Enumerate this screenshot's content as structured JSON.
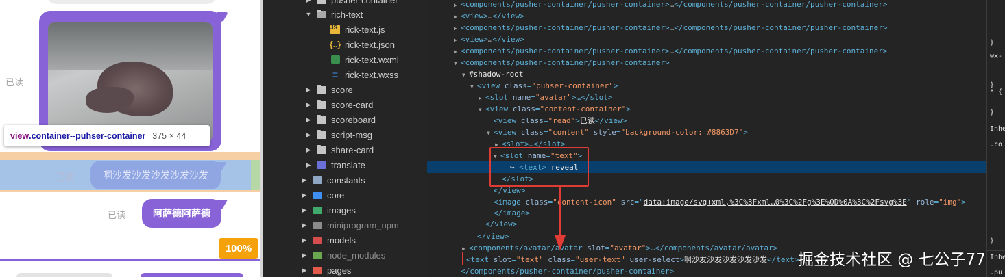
{
  "simulator": {
    "read_label_1": "已读",
    "tooltip": {
      "tag": "view",
      "class_name": ".container--puhser-container",
      "dims": "375 × 44"
    },
    "read_label_2": "已读",
    "highlight_text": "啊沙发沙发沙发沙发沙发",
    "read_label_3": "已读",
    "message_text": "阿萨德阿萨德",
    "percent_badge": "100%"
  },
  "file_tree": {
    "items": [
      {
        "label": "pusher-container",
        "type": "folder"
      },
      {
        "label": "rich-text",
        "type": "folder-open"
      },
      {
        "label": "rick-text.js",
        "type": "js"
      },
      {
        "label": "rick-text.json",
        "type": "json"
      },
      {
        "label": "rick-text.wxml",
        "type": "wxml"
      },
      {
        "label": "rick-text.wxss",
        "type": "wxss"
      },
      {
        "label": "score",
        "type": "folder"
      },
      {
        "label": "score-card",
        "type": "folder"
      },
      {
        "label": "scoreboard",
        "type": "folder"
      },
      {
        "label": "script-msg",
        "type": "folder"
      },
      {
        "label": "share-card",
        "type": "folder"
      },
      {
        "label": "translate",
        "type": "translate"
      },
      {
        "label": "constants",
        "type": "constants"
      },
      {
        "label": "core",
        "type": "core"
      },
      {
        "label": "images",
        "type": "images"
      },
      {
        "label": "miniprogram_npm",
        "type": "npm"
      },
      {
        "label": "models",
        "type": "models"
      },
      {
        "label": "node_modules",
        "type": "node"
      },
      {
        "label": "pages",
        "type": "pages"
      }
    ]
  },
  "elements": {
    "rows": [
      {
        "open": "<components/pusher-container/pusher-container>",
        "ellipsis": "…",
        "close": "</components/pusher-container/pusher-container>"
      },
      {
        "open": "<view>",
        "ellipsis": "…",
        "close": "</view>"
      },
      {
        "open": "<components/pusher-container/pusher-container>",
        "ellipsis": "…",
        "close": "</components/pusher-container/pusher-container>"
      },
      {
        "open": "<view>",
        "ellipsis": "…",
        "close": "</view>"
      },
      {
        "open": "<components/pusher-container/pusher-container>",
        "ellipsis": "…",
        "close": "</components/pusher-container/pusher-container>"
      },
      {
        "open": "<components/pusher-container/pusher-container>"
      }
    ],
    "shadow_root": "#shadow-root",
    "view_puhser": {
      "tag": "<view",
      "attr": "class",
      "val": "\"puhser-container\"",
      "end": ">"
    },
    "slot_avatar": {
      "tag": "<slot",
      "attr": "name",
      "val": "\"avatar\"",
      "end": ">…</slot>"
    },
    "view_content_container": {
      "tag": "<view",
      "attr": "class",
      "val": "\"content-container\"",
      "end": ">"
    },
    "view_read": {
      "tag": "<view",
      "attr": "class",
      "val": "\"read\"",
      "text": "已读",
      "close": "</view>"
    },
    "view_content": {
      "tag": "<view",
      "attr1": "class",
      "val1": "\"content\"",
      "attr2": "style",
      "val2": "\"background-color: #8863D7\"",
      "end": ">"
    },
    "slot_collapsed": "<slot>…</slot>",
    "slot_text": {
      "tag": "<slot",
      "attr": "name",
      "val": "\"text\"",
      "end": ">"
    },
    "reveal_row": {
      "arrow": "↪",
      "tag": "<text>",
      "text": "reveal"
    },
    "slot_close": "</slot>",
    "view_close_1": "</view>",
    "image_row": {
      "tag": "<image",
      "attr1": "class",
      "val1": "\"content-icon\"",
      "attr2": "src",
      "val2": "data:image/svg+xml,%3C%3Fxml…0%3C%2Fg%3E%0D%0A%3C%2Fsvg%3E",
      "attr3": "role",
      "val3": "\"img\"",
      "end": ">"
    },
    "image_close": "</image>",
    "view_close_2": "</view>",
    "view_close_3": "</view>",
    "avatar_row": {
      "open": "<components/avatar/avatar",
      "attr": "slot",
      "val": "\"avatar\"",
      "end": ">…</components/avatar/avatar>"
    },
    "text_row": {
      "tag": "<text",
      "attr1": "slot",
      "val1": "\"text\"",
      "attr2": "class",
      "val2": "\"user-text\"",
      "attr3": "user-select",
      "end": ">",
      "content": "啊沙发沙发沙发沙发沙发",
      "close": "</text>"
    },
    "pusher_close": "</components/pusher-container/pusher-container>"
  },
  "styles_panel": {
    "rows": [
      "}",
      "wx-",
      "}",
      "* {",
      "}",
      "Inhe",
      ".co",
      "}",
      "Inhe",
      ".pu"
    ]
  },
  "watermark": "掘金技术社区 @ 七公子77",
  "colors": {
    "accent": "#8863D7",
    "highlight": "#a4c3e7",
    "badge": "#f5a20a",
    "annotation": "#e03b35"
  },
  "icons": [
    "folder-icon",
    "js-file-icon",
    "json-file-icon",
    "wxml-file-icon",
    "wxss-file-icon",
    "translate-icon",
    "expand-triangle-icon",
    "collapse-triangle-icon"
  ]
}
